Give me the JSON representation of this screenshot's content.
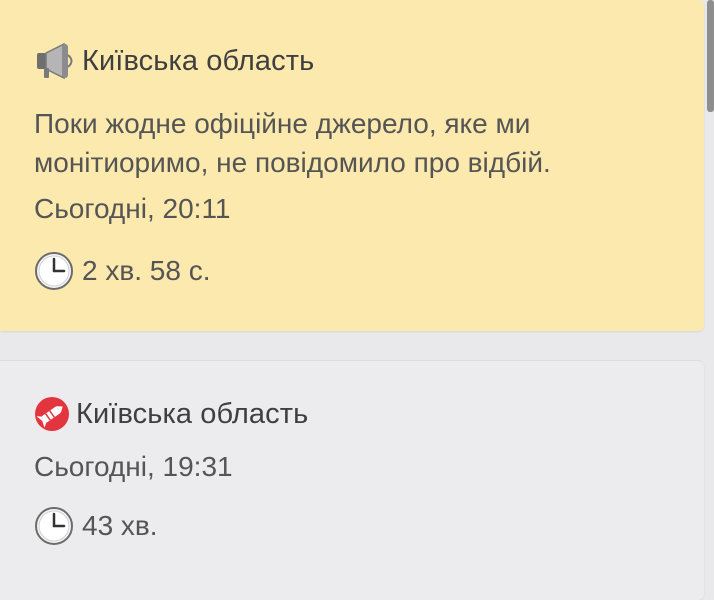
{
  "alerts": [
    {
      "region": "Київська область",
      "icon": "megaphone-icon",
      "message": "Поки жодне офіційне джерело, яке ми монітиоримо, не повідомило про відбій.",
      "time": "Сьогодні, 20:11",
      "duration": "2 хв. 58 с.",
      "background_color": "#fbe9ad"
    },
    {
      "region": "Київська область",
      "icon": "rocket-badge-icon",
      "time": "Сьогодні, 19:31",
      "duration": "43 хв.",
      "background_color": "#ececee",
      "icon_color": "#e2353f"
    }
  ],
  "clock_icon": "clock-icon"
}
